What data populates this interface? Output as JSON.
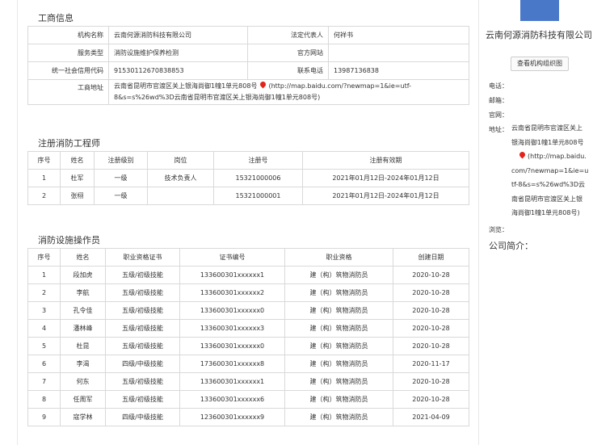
{
  "business": {
    "title": "工商信息",
    "org_name_label": "机构名称",
    "org_name": "云南何源消防科技有限公司",
    "legal_rep_label": "法定代表人",
    "legal_rep": "何祥书",
    "service_type_label": "服务类型",
    "service_type": "消防设施维护保养检测",
    "website_label": "官方网站",
    "website": "",
    "credit_code_label": "统一社会信用代码",
    "credit_code": "91530112670838853",
    "phone_label": "联系电话",
    "phone": "13987136838",
    "address_label": "工商地址",
    "address": "云南省昆明市官渡区关上银海尚御1幢1单元808号",
    "map_link": "(http://map.baidu.com/?newmap=1&ie=utf-8&s=s%26wd%3D云南省昆明市官渡区关上银海尚御1幢1单元808号)"
  },
  "engineers": {
    "title": "注册消防工程师",
    "headers": [
      "序号",
      "姓名",
      "注册级别",
      "岗位",
      "注册号",
      "注册有效期"
    ],
    "rows": [
      [
        "1",
        "杜军",
        "一级",
        "技术负责人",
        "15321000006",
        "2021年01月12日-2024年01月12日"
      ],
      [
        "2",
        "张栩",
        "一级",
        "",
        "15321000001",
        "2021年01月12日-2024年01月12日"
      ]
    ]
  },
  "operators": {
    "title": "消防设施操作员",
    "headers": [
      "序号",
      "姓名",
      "职业资格证书",
      "证书编号",
      "职业资格",
      "创建日期"
    ],
    "rows": [
      [
        "1",
        "段加虎",
        "五级/初级技能",
        "133600301xxxxxx1",
        "建（构）筑物消防员",
        "2020-10-28"
      ],
      [
        "2",
        "李航",
        "五级/初级技能",
        "133600301xxxxxx2",
        "建（构）筑物消防员",
        "2020-10-28"
      ],
      [
        "3",
        "孔令佳",
        "五级/初级技能",
        "133600301xxxxxx0",
        "建（构）筑物消防员",
        "2020-10-28"
      ],
      [
        "4",
        "潘林峰",
        "五级/初级技能",
        "133600301xxxxxx3",
        "建（构）筑物消防员",
        "2020-10-28"
      ],
      [
        "5",
        "杜昆",
        "五级/初级技能",
        "133600301xxxxxx0",
        "建（构）筑物消防员",
        "2020-10-28"
      ],
      [
        "6",
        "李渴",
        "四级/中级技能",
        "173600301xxxxxx8",
        "建（构）筑物消防员",
        "2020-11-17"
      ],
      [
        "7",
        "何东",
        "五级/初级技能",
        "133600301xxxxxx1",
        "建（构）筑物消防员",
        "2020-10-28"
      ],
      [
        "8",
        "任周军",
        "五级/初级技能",
        "133600301xxxxxx6",
        "建（构）筑物消防员",
        "2020-10-28"
      ],
      [
        "9",
        "寇学林",
        "四级/中级技能",
        "123600301xxxxxx9",
        "建（构）筑物消防员",
        "2021-04-09"
      ]
    ]
  },
  "sidebar": {
    "company_name": "云南何源消防科技有限公司",
    "org_chart_button": "查看机构组织图",
    "phone_label": "电话：",
    "email_label": "邮箱：",
    "website_label": "官网：",
    "address_label": "地址：",
    "address_lines": [
      "云南省昆明市官渡区关上",
      "银海尚御1幢1单元808号",
      "(http://map.baidu.",
      "com/?newmap=1&ie=u",
      "tf-8&s=s%26wd%3D云",
      "南省昆明市官渡区关上银",
      "海尚御1幢1单元808号)"
    ],
    "views_label": "浏览：",
    "intro_title": "公司简介："
  },
  "colors": {
    "border": "#d9d9d9",
    "pin": "#e2231a",
    "logo": "#4a78c9"
  }
}
